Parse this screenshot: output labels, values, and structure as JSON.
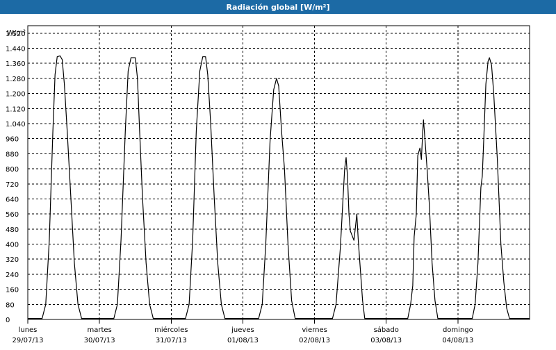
{
  "window": {
    "title": "Radiación global [W/m²]"
  },
  "colors": {
    "titlebar": "#1c6aa5",
    "line": "#000000",
    "grid": "#000000",
    "background": "#ffffff"
  },
  "chart_data": {
    "type": "line",
    "title": "Radiación global [W/m²]",
    "ylabel": "W/m²",
    "xlabel": "",
    "ylim": [
      0,
      1560
    ],
    "yticks": [
      0,
      80,
      160,
      240,
      320,
      400,
      480,
      560,
      640,
      720,
      800,
      880,
      960,
      1040,
      1120,
      1200,
      1280,
      1360,
      1440,
      1520
    ],
    "ytick_labels": [
      "0",
      "80",
      "160",
      "240",
      "320",
      "400",
      "480",
      "560",
      "640",
      "720",
      "800",
      "880",
      "960",
      "1.040",
      "1.120",
      "1.200",
      "1.280",
      "1.360",
      "1.440",
      "1.520"
    ],
    "xlim": [
      0,
      7
    ],
    "x_unit": "days since 29/07/13 00:00",
    "days": [
      {
        "name": "lunes",
        "date": "29/07/13"
      },
      {
        "name": "martes",
        "date": "30/07/13"
      },
      {
        "name": "miércoles",
        "date": "31/07/13"
      },
      {
        "name": "jueves",
        "date": "01/08/13"
      },
      {
        "name": "viernes",
        "date": "02/08/13"
      },
      {
        "name": "sábado",
        "date": "03/08/13"
      },
      {
        "name": "domingo",
        "date": "04/08/13"
      }
    ],
    "grid": true,
    "series": [
      {
        "name": "Radiación global",
        "points": [
          [
            0.0,
            5
          ],
          [
            0.2,
            5
          ],
          [
            0.25,
            80
          ],
          [
            0.3,
            420
          ],
          [
            0.35,
            1000
          ],
          [
            0.38,
            1300
          ],
          [
            0.41,
            1395
          ],
          [
            0.45,
            1400
          ],
          [
            0.48,
            1380
          ],
          [
            0.51,
            1250
          ],
          [
            0.55,
            1000
          ],
          [
            0.6,
            650
          ],
          [
            0.65,
            300
          ],
          [
            0.7,
            80
          ],
          [
            0.75,
            5
          ],
          [
            1.2,
            5
          ],
          [
            1.25,
            80
          ],
          [
            1.3,
            420
          ],
          [
            1.36,
            1000
          ],
          [
            1.4,
            1320
          ],
          [
            1.44,
            1390
          ],
          [
            1.5,
            1390
          ],
          [
            1.53,
            1280
          ],
          [
            1.56,
            1000
          ],
          [
            1.6,
            650
          ],
          [
            1.65,
            300
          ],
          [
            1.7,
            80
          ],
          [
            1.75,
            5
          ],
          [
            2.2,
            5
          ],
          [
            2.25,
            80
          ],
          [
            2.3,
            420
          ],
          [
            2.35,
            1000
          ],
          [
            2.4,
            1320
          ],
          [
            2.44,
            1395
          ],
          [
            2.48,
            1395
          ],
          [
            2.51,
            1300
          ],
          [
            2.55,
            1050
          ],
          [
            2.6,
            650
          ],
          [
            2.65,
            300
          ],
          [
            2.7,
            80
          ],
          [
            2.75,
            5
          ],
          [
            3.22,
            5
          ],
          [
            3.27,
            80
          ],
          [
            3.32,
            400
          ],
          [
            3.38,
            950
          ],
          [
            3.43,
            1220
          ],
          [
            3.47,
            1280
          ],
          [
            3.5,
            1240
          ],
          [
            3.54,
            1000
          ],
          [
            3.58,
            800
          ],
          [
            3.63,
            400
          ],
          [
            3.68,
            100
          ],
          [
            3.73,
            5
          ],
          [
            4.25,
            5
          ],
          [
            4.3,
            80
          ],
          [
            4.36,
            380
          ],
          [
            4.42,
            800
          ],
          [
            4.44,
            860
          ],
          [
            4.46,
            760
          ],
          [
            4.48,
            560
          ],
          [
            4.5,
            470
          ],
          [
            4.53,
            440
          ],
          [
            4.55,
            420
          ],
          [
            4.57,
            490
          ],
          [
            4.59,
            560
          ],
          [
            4.61,
            420
          ],
          [
            4.64,
            260
          ],
          [
            4.67,
            100
          ],
          [
            4.7,
            5
          ],
          [
            5.3,
            5
          ],
          [
            5.34,
            80
          ],
          [
            5.37,
            180
          ],
          [
            5.39,
            440
          ],
          [
            5.42,
            560
          ],
          [
            5.44,
            870
          ],
          [
            5.47,
            910
          ],
          [
            5.49,
            850
          ],
          [
            5.51,
            1000
          ],
          [
            5.52,
            1060
          ],
          [
            5.54,
            960
          ],
          [
            5.57,
            800
          ],
          [
            5.6,
            620
          ],
          [
            5.64,
            300
          ],
          [
            5.68,
            100
          ],
          [
            5.72,
            5
          ],
          [
            6.2,
            5
          ],
          [
            6.24,
            80
          ],
          [
            6.28,
            300
          ],
          [
            6.32,
            700
          ],
          [
            6.34,
            760
          ],
          [
            6.36,
            950
          ],
          [
            6.39,
            1250
          ],
          [
            6.42,
            1370
          ],
          [
            6.44,
            1390
          ],
          [
            6.47,
            1350
          ],
          [
            6.5,
            1200
          ],
          [
            6.55,
            850
          ],
          [
            6.6,
            400
          ],
          [
            6.64,
            200
          ],
          [
            6.68,
            60
          ],
          [
            6.72,
            5
          ],
          [
            6.76,
            5
          ],
          [
            7.0,
            5
          ]
        ]
      }
    ]
  }
}
